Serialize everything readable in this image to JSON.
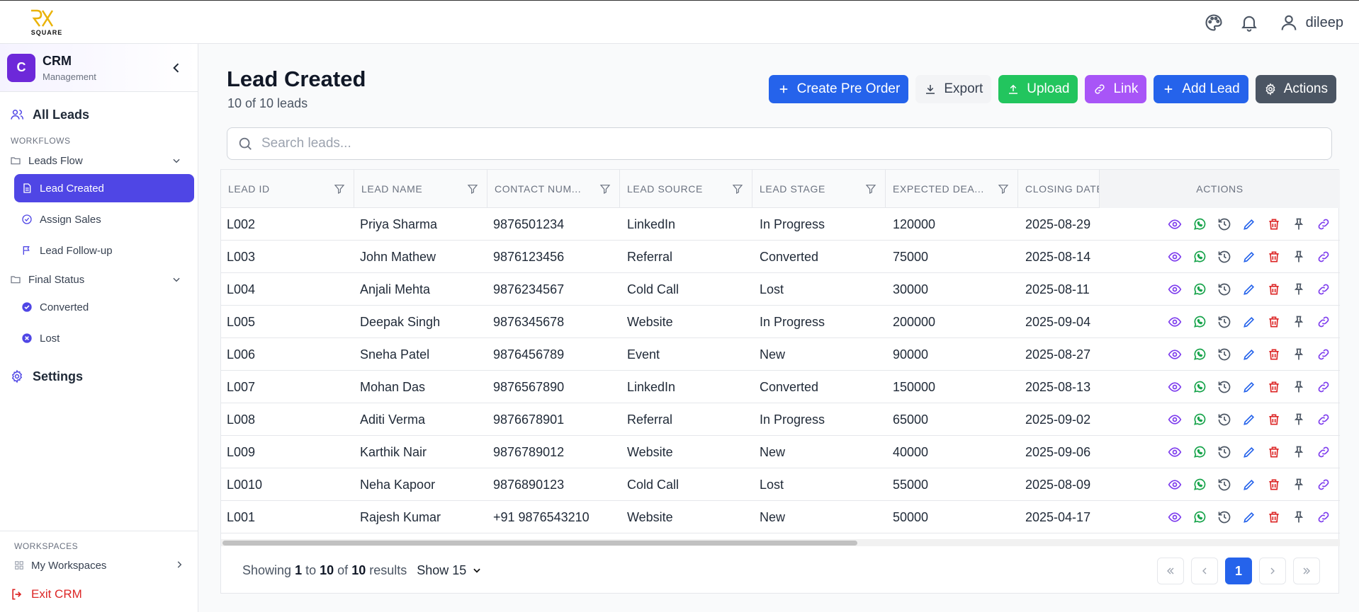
{
  "app": {
    "logo_text": "SQUARE",
    "user_name": "dileep"
  },
  "sidebar": {
    "brand_letter": "C",
    "brand_title": "CRM",
    "brand_subtitle": "Management",
    "all_leads": "All Leads",
    "workflows_label": "WORKFLOWS",
    "leads_flow": "Leads Flow",
    "leads_flow_items": [
      "Lead Created",
      "Assign Sales",
      "Lead Follow-up"
    ],
    "final_status": "Final Status",
    "final_status_items": [
      "Converted",
      "Lost"
    ],
    "settings": "Settings",
    "workspaces_label": "WORKSPACES",
    "my_workspaces": "My Workspaces",
    "exit": "Exit CRM"
  },
  "page": {
    "title": "Lead Created",
    "subtitle": "10 of 10 leads",
    "search_placeholder": "Search leads..."
  },
  "toolbar": {
    "create_pre_order": "Create Pre Order",
    "export": "Export",
    "upload": "Upload",
    "link": "Link",
    "add_lead": "Add Lead",
    "actions": "Actions"
  },
  "table": {
    "columns": [
      "LEAD ID",
      "LEAD NAME",
      "CONTACT NUM...",
      "LEAD SOURCE",
      "LEAD STAGE",
      "EXPECTED DEA...",
      "CLOSING DATE",
      "ACTIONS"
    ],
    "rows": [
      [
        "L002",
        "Priya Sharma",
        "9876501234",
        "LinkedIn",
        "In Progress",
        "120000",
        "2025-08-29"
      ],
      [
        "L003",
        "John Mathew",
        "9876123456",
        "Referral",
        "Converted",
        "75000",
        "2025-08-14"
      ],
      [
        "L004",
        "Anjali Mehta",
        "9876234567",
        "Cold Call",
        "Lost",
        "30000",
        "2025-08-11"
      ],
      [
        "L005",
        "Deepak Singh",
        "9876345678",
        "Website",
        "In Progress",
        "200000",
        "2025-09-04"
      ],
      [
        "L006",
        "Sneha Patel",
        "9876456789",
        "Event",
        "New",
        "90000",
        "2025-08-27"
      ],
      [
        "L007",
        "Mohan Das",
        "9876567890",
        "LinkedIn",
        "Converted",
        "150000",
        "2025-08-13"
      ],
      [
        "L008",
        "Aditi Verma",
        "9876678901",
        "Referral",
        "In Progress",
        "65000",
        "2025-09-02"
      ],
      [
        "L009",
        "Karthik Nair",
        "9876789012",
        "Website",
        "New",
        "40000",
        "2025-09-06"
      ],
      [
        "L0010",
        "Neha Kapoor",
        "9876890123",
        "Cold Call",
        "Lost",
        "55000",
        "2025-08-09"
      ],
      [
        "L001",
        "Rajesh Kumar",
        "+91 9876543210",
        "Website",
        "New",
        "50000",
        "2025-04-17"
      ]
    ],
    "action_icons": [
      "eye-icon",
      "whatsapp-icon",
      "history-icon",
      "edit-icon",
      "delete-icon",
      "pin-icon",
      "link-icon"
    ]
  },
  "footer": {
    "showing_prefix": "Showing",
    "from": "1",
    "to_word": "to",
    "to": "10",
    "of_word": "of",
    "total": "10",
    "results_word": "results",
    "show_select": "Show 15",
    "current_page": "1"
  },
  "colors": {
    "primary": "#2563eb",
    "active_nav": "#4f46e5",
    "brand": "#6d28d9",
    "green": "#22c55e",
    "purple": "#a855f7",
    "danger": "#dc2626"
  }
}
